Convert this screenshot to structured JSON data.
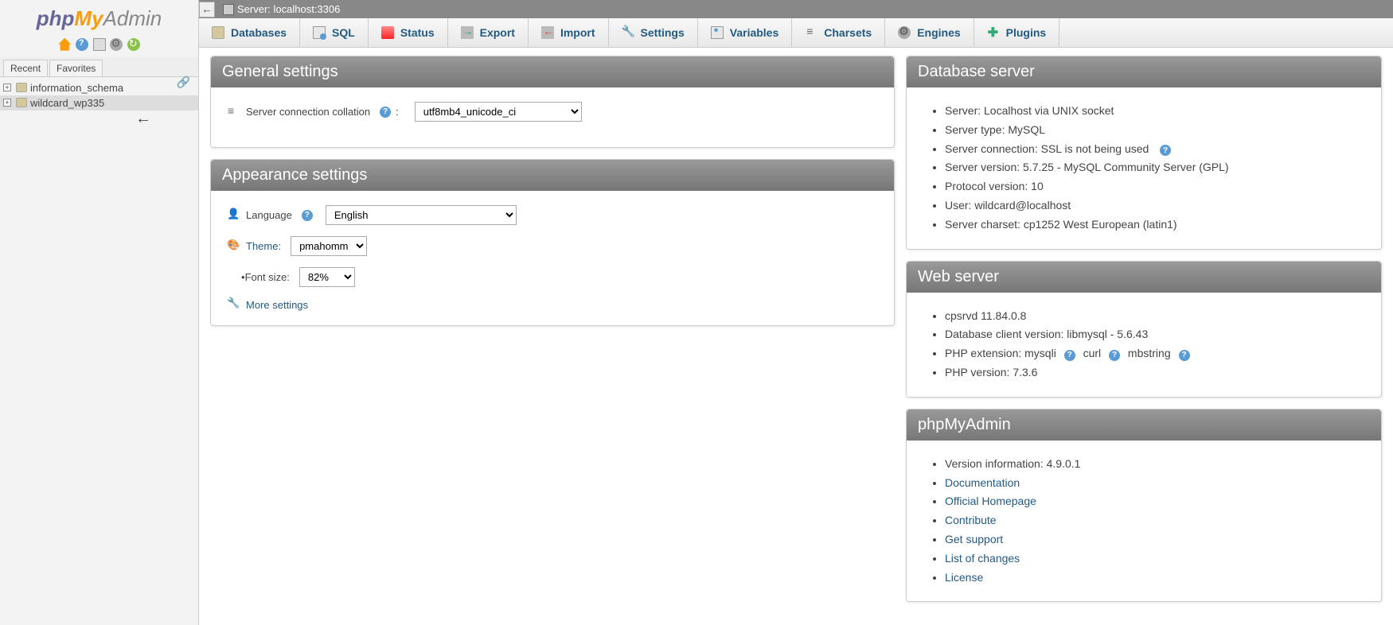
{
  "logo": {
    "php": "php",
    "my": "My",
    "admin": "Admin"
  },
  "sidebar": {
    "tabs": {
      "recent": "Recent",
      "favorites": "Favorites"
    },
    "dbs": [
      "information_schema",
      "wildcard_wp335"
    ]
  },
  "breadcrumb": {
    "label": "Server: localhost:3306"
  },
  "topnav": {
    "databases": "Databases",
    "sql": "SQL",
    "status": "Status",
    "export": "Export",
    "import": "Import",
    "settings": "Settings",
    "variables": "Variables",
    "charsets": "Charsets",
    "engines": "Engines",
    "plugins": "Plugins"
  },
  "general": {
    "title": "General settings",
    "collation_label": "Server connection collation",
    "collation_value": "utf8mb4_unicode_ci"
  },
  "appearance": {
    "title": "Appearance settings",
    "language_label": "Language",
    "language_value": "English",
    "theme_label": "Theme:",
    "theme_value": "pmahomme",
    "fontsize_label": "Font size:",
    "fontsize_value": "82%",
    "more_settings": "More settings"
  },
  "db_server": {
    "title": "Database server",
    "items": [
      "Server: Localhost via UNIX socket",
      "Server type: MySQL",
      "Server connection: SSL is not being used",
      "Server version: 5.7.25 - MySQL Community Server (GPL)",
      "Protocol version: 10",
      "User: wildcard@localhost",
      "Server charset: cp1252 West European (latin1)"
    ]
  },
  "web_server": {
    "title": "Web server",
    "items": [
      "cpsrvd 11.84.0.8",
      "Database client version: libmysql - 5.6.43",
      "PHP extension: mysqli   curl   mbstring",
      "PHP version: 7.3.6"
    ]
  },
  "pma": {
    "title": "phpMyAdmin",
    "version_label": "Version information: 4.9.0.1",
    "links": [
      "Documentation",
      "Official Homepage",
      "Contribute",
      "Get support",
      "List of changes",
      "License"
    ]
  }
}
